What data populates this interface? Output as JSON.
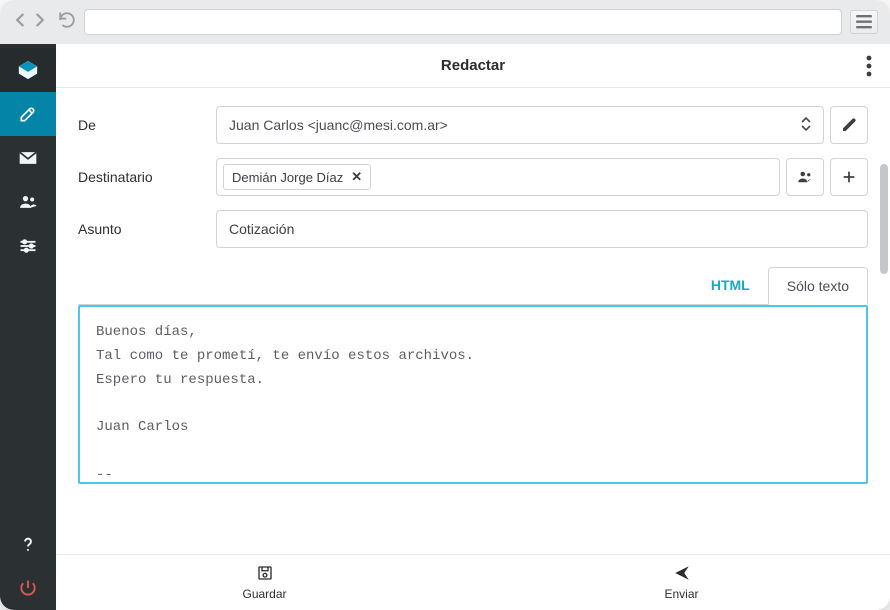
{
  "header": {
    "title": "Redactar"
  },
  "form": {
    "from": {
      "label": "De",
      "value": "Juan Carlos <juanc@mesi.com.ar>"
    },
    "to": {
      "label": "Destinatario",
      "chip": "Demián Jorge Díaz"
    },
    "subject": {
      "label": "Asunto",
      "value": "Cotización"
    }
  },
  "tabs": {
    "html": "HTML",
    "plain": "Sólo texto"
  },
  "body_text": "Buenos días,\nTal como te prometí, te envío estos archivos.\nEspero tu respuesta.\n\nJuan Carlos\n\n--",
  "footer": {
    "save": "Guardar",
    "send": "Enviar"
  }
}
